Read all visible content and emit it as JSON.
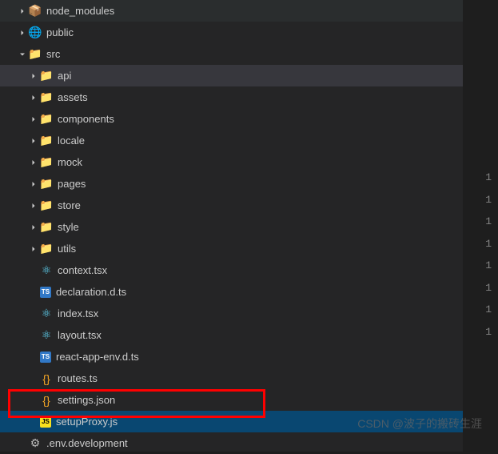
{
  "tree": [
    {
      "label": "node_modules",
      "depth": 1,
      "type": "folder",
      "expanded": false,
      "icon": "folder-green",
      "glyph": "📦"
    },
    {
      "label": "public",
      "depth": 1,
      "type": "folder",
      "expanded": false,
      "icon": "folder-teal",
      "glyph": "🌐"
    },
    {
      "label": "src",
      "depth": 1,
      "type": "folder",
      "expanded": true,
      "icon": "folder-green",
      "glyph": "📁"
    },
    {
      "label": "api",
      "depth": 2,
      "type": "folder",
      "expanded": false,
      "icon": "folder-icon",
      "glyph": "📁",
      "state": "active"
    },
    {
      "label": "assets",
      "depth": 2,
      "type": "folder",
      "expanded": false,
      "icon": "folder-icon",
      "glyph": "📁"
    },
    {
      "label": "components",
      "depth": 2,
      "type": "folder",
      "expanded": false,
      "icon": "folder-green",
      "glyph": "📁"
    },
    {
      "label": "locale",
      "depth": 2,
      "type": "folder",
      "expanded": false,
      "icon": "folder-blue",
      "glyph": "📁"
    },
    {
      "label": "mock",
      "depth": 2,
      "type": "folder",
      "expanded": false,
      "icon": "folder-grey",
      "glyph": "📁"
    },
    {
      "label": "pages",
      "depth": 2,
      "type": "folder",
      "expanded": false,
      "icon": "folder-red",
      "glyph": "📁"
    },
    {
      "label": "store",
      "depth": 2,
      "type": "folder",
      "expanded": false,
      "icon": "folder-grey",
      "glyph": "📁"
    },
    {
      "label": "style",
      "depth": 2,
      "type": "folder",
      "expanded": false,
      "icon": "folder-blue",
      "glyph": "📁"
    },
    {
      "label": "utils",
      "depth": 2,
      "type": "folder",
      "expanded": false,
      "icon": "folder-green",
      "glyph": "📁"
    },
    {
      "label": "context.tsx",
      "depth": 2,
      "type": "file",
      "icon": "react-icon",
      "glyph": "⚛"
    },
    {
      "label": "declaration.d.ts",
      "depth": 2,
      "type": "file",
      "icon": "ts-icon",
      "glyph": "TS"
    },
    {
      "label": "index.tsx",
      "depth": 2,
      "type": "file",
      "icon": "react-icon",
      "glyph": "⚛"
    },
    {
      "label": "layout.tsx",
      "depth": 2,
      "type": "file",
      "icon": "react-icon",
      "glyph": "⚛"
    },
    {
      "label": "react-app-env.d.ts",
      "depth": 2,
      "type": "file",
      "icon": "ts-icon",
      "glyph": "TS"
    },
    {
      "label": "routes.ts",
      "depth": 2,
      "type": "file",
      "icon": "json-icon",
      "glyph": "{}"
    },
    {
      "label": "settings.json",
      "depth": 2,
      "type": "file",
      "icon": "json-icon",
      "glyph": "{}"
    },
    {
      "label": "setupProxy.js",
      "depth": 2,
      "type": "file",
      "icon": "js-icon",
      "glyph": "JS",
      "state": "selected"
    },
    {
      "label": ".env.development",
      "depth": 1,
      "type": "file",
      "icon": "gear-icon",
      "glyph": "⚙"
    }
  ],
  "editorLines": [
    "1",
    "1",
    "1",
    "1",
    "1",
    "1",
    "1",
    "1"
  ],
  "watermark": "CSDN @波子的搬砖生涯"
}
